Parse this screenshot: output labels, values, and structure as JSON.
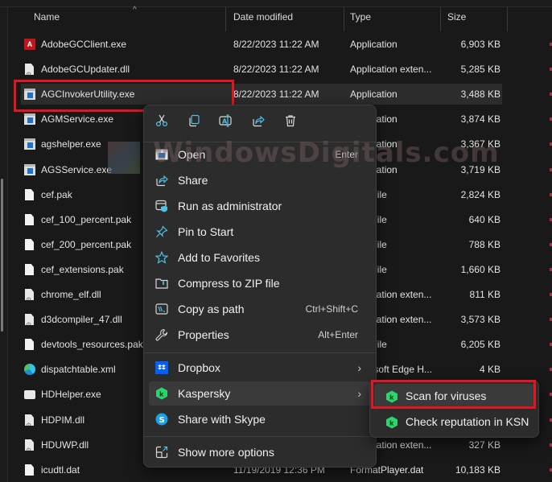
{
  "columns": {
    "name": "Name",
    "date_modified": "Date modified",
    "type": "Type",
    "size": "Size"
  },
  "files": [
    {
      "name": "AdobeGCClient.exe",
      "date": "8/22/2023 11:22 AM",
      "type": "Application",
      "size": "6,903 KB",
      "icon": "adobe-icon"
    },
    {
      "name": "AdobeGCUpdater.dll",
      "date": "8/22/2023 11:22 AM",
      "type": "Application exten...",
      "size": "5,285 KB",
      "icon": "dll-icon"
    },
    {
      "name": "AGCInvokerUtility.exe",
      "date": "8/22/2023 11:22 AM",
      "type": "Application",
      "size": "3,488 KB",
      "icon": "exe-icon",
      "selected": true
    },
    {
      "name": "AGMService.exe",
      "date": "",
      "type": "Application",
      "size": "3,874 KB",
      "icon": "exe-icon"
    },
    {
      "name": "agshelper.exe",
      "date": "",
      "type": "Application",
      "size": "3,367 KB",
      "icon": "exe-icon"
    },
    {
      "name": "AGSService.exe",
      "date": "",
      "type": "Application",
      "size": "3,719 KB",
      "icon": "exe-icon"
    },
    {
      "name": "cef.pak",
      "date": "",
      "type": "PAK File",
      "size": "2,824 KB",
      "icon": "file-icon"
    },
    {
      "name": "cef_100_percent.pak",
      "date": "",
      "type": "PAK File",
      "size": "640 KB",
      "icon": "file-icon"
    },
    {
      "name": "cef_200_percent.pak",
      "date": "",
      "type": "PAK File",
      "size": "788 KB",
      "icon": "file-icon"
    },
    {
      "name": "cef_extensions.pak",
      "date": "",
      "type": "PAK File",
      "size": "1,660 KB",
      "icon": "file-icon"
    },
    {
      "name": "chrome_elf.dll",
      "date": "",
      "type": "Application exten...",
      "size": "811 KB",
      "icon": "dll-icon"
    },
    {
      "name": "d3dcompiler_47.dll",
      "date": "",
      "type": "Application exten...",
      "size": "3,573 KB",
      "icon": "dll-icon"
    },
    {
      "name": "devtools_resources.pak",
      "date": "",
      "type": "PAK File",
      "size": "6,205 KB",
      "icon": "file-icon"
    },
    {
      "name": "dispatchtable.xml",
      "date": "",
      "type": "Microsoft Edge H...",
      "size": "4 KB",
      "icon": "edge-icon"
    },
    {
      "name": "HDHelper.exe",
      "date": "",
      "type": "",
      "size": "",
      "icon": "app-icon"
    },
    {
      "name": "HDPIM.dll",
      "date": "",
      "type": "",
      "size": "",
      "icon": "dll-icon"
    },
    {
      "name": "HDUWP.dll",
      "date": "",
      "type": "Application exten...",
      "size": "327 KB",
      "icon": "dll-icon"
    },
    {
      "name": "icudtl.dat",
      "date": "11/19/2019 12:36 PM",
      "type": "FormatPlayer.dat",
      "size": "10,183 KB",
      "icon": "file-icon"
    }
  ],
  "context_menu": {
    "quick_actions": [
      {
        "name": "cut",
        "icon": "scissors-icon"
      },
      {
        "name": "copy",
        "icon": "copy-icon"
      },
      {
        "name": "rename",
        "icon": "rename-icon"
      },
      {
        "name": "share",
        "icon": "share-icon"
      },
      {
        "name": "delete",
        "icon": "trash-icon"
      }
    ],
    "items": [
      {
        "label": "Open",
        "shortcut": "Enter",
        "icon": "app-window-icon"
      },
      {
        "label": "Share",
        "shortcut": "",
        "icon": "share-icon"
      },
      {
        "label": "Run as administrator",
        "shortcut": "",
        "icon": "shield-icon"
      },
      {
        "label": "Pin to Start",
        "shortcut": "",
        "icon": "pin-icon"
      },
      {
        "label": "Add to Favorites",
        "shortcut": "",
        "icon": "star-icon"
      },
      {
        "label": "Compress to ZIP file",
        "shortcut": "",
        "icon": "zip-folder-icon"
      },
      {
        "label": "Copy as path",
        "shortcut": "Ctrl+Shift+C",
        "icon": "copy-path-icon"
      },
      {
        "label": "Properties",
        "shortcut": "Alt+Enter",
        "icon": "wrench-icon"
      },
      {
        "label": "Dropbox",
        "shortcut": "",
        "icon": "dropbox-icon",
        "submenu": true
      },
      {
        "label": "Kaspersky",
        "shortcut": "",
        "icon": "kaspersky-icon",
        "submenu": true,
        "hover": true
      },
      {
        "label": "Share with Skype",
        "shortcut": "",
        "icon": "skype-icon"
      },
      {
        "label": "Show more options",
        "shortcut": "",
        "icon": "more-options-icon"
      }
    ]
  },
  "kaspersky_submenu": {
    "items": [
      {
        "label": "Scan for viruses",
        "icon": "kaspersky-icon",
        "highlighted": true
      },
      {
        "label": "Check reputation in KSN",
        "icon": "kaspersky-icon"
      }
    ]
  },
  "watermark": "WindowsDigitals.com",
  "accent_colors": {
    "highlight_box": "#e3151e",
    "icon_accent": "#4cc2e6",
    "kaspersky_green": "#2fd36b"
  }
}
